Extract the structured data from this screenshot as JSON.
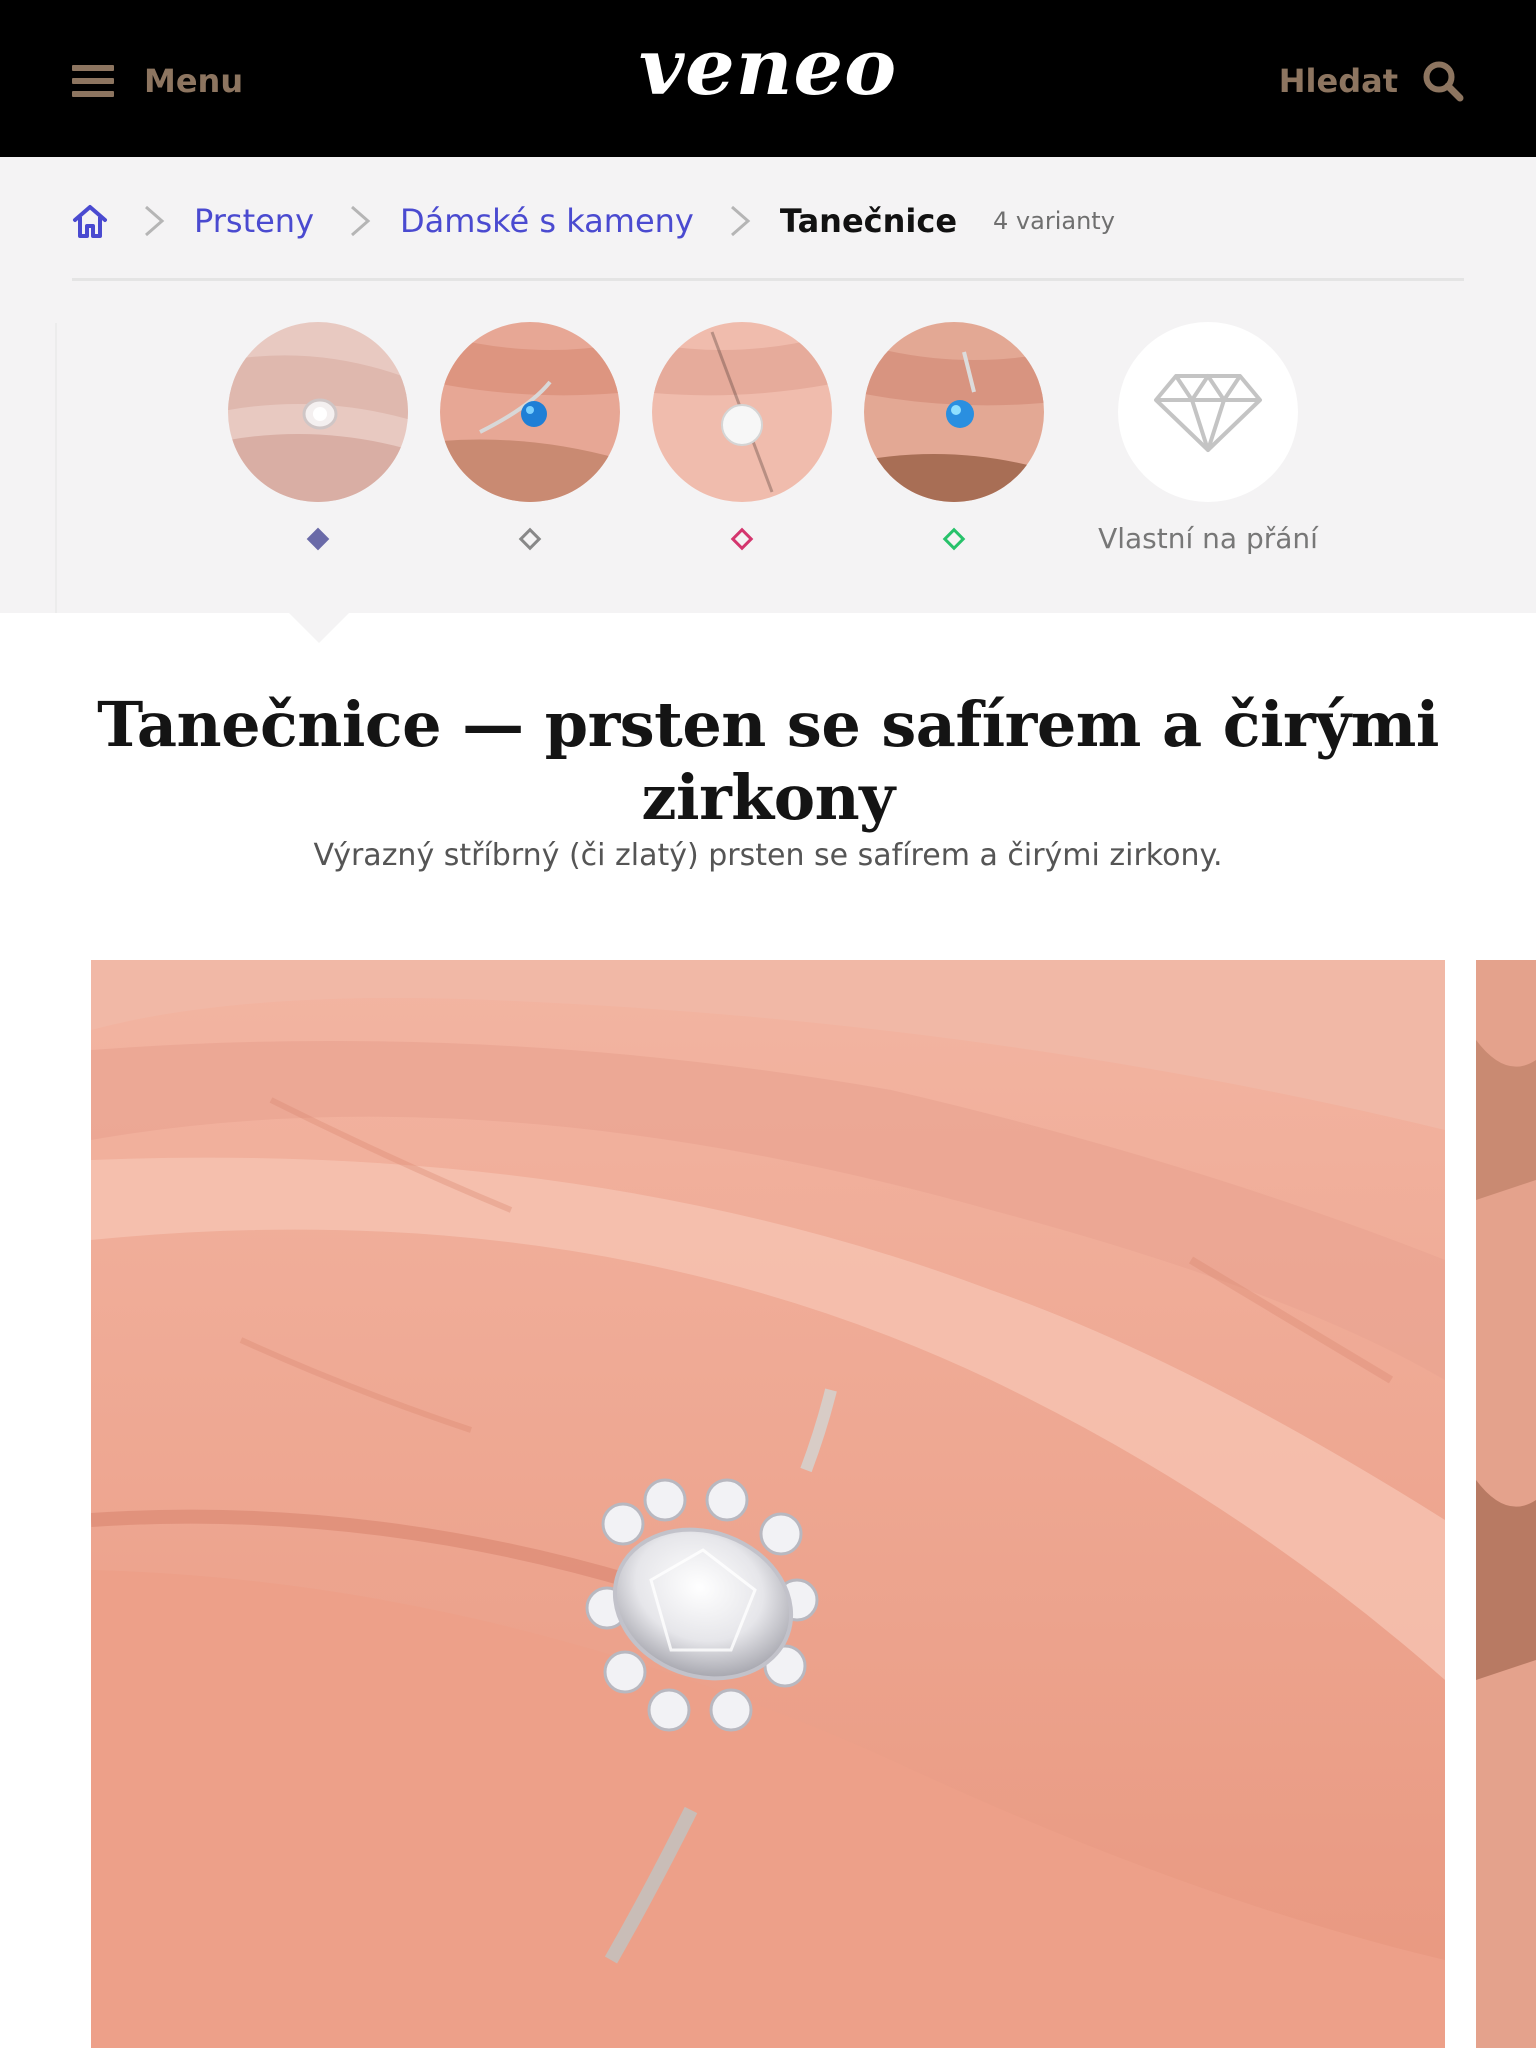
{
  "header": {
    "menu_label": "Menu",
    "logo": "veneo",
    "search_label": "Hledat",
    "brand_color": "#8d7560"
  },
  "breadcrumb": {
    "home_icon": "home-icon",
    "items": [
      "Prsteny",
      "Dámské s kameny"
    ],
    "current": "Tanečnice",
    "count": "4 varianty"
  },
  "variants": [
    {
      "name": "white-zircon-flower",
      "dot_color": "#6a6aa8",
      "dot_style": "filled"
    },
    {
      "name": "blue-opal-wave",
      "dot_color": "#888888",
      "dot_style": "outline"
    },
    {
      "name": "white-opal",
      "dot_color": "#d4366e",
      "dot_style": "outline"
    },
    {
      "name": "blue-opal",
      "dot_color": "#27c26a",
      "dot_style": "outline"
    }
  ],
  "custom_variant": {
    "label": "Vlastní na přání",
    "icon": "diamond-icon"
  },
  "product": {
    "title": "Tanečnice — prsten se safírem a čirými zirkony",
    "description": "Výrazný stříbrný (či zlatý) prsten se safírem a čirými zirkony."
  }
}
